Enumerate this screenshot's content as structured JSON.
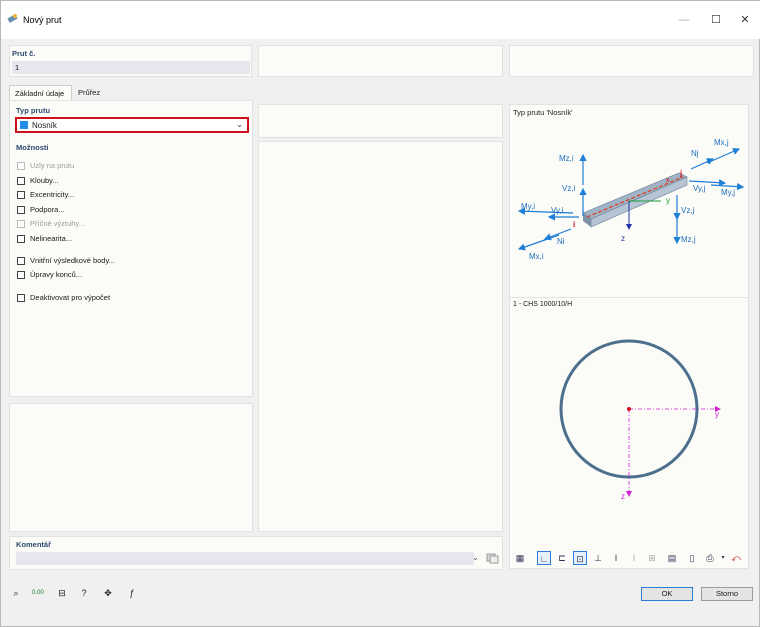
{
  "window": {
    "title": "Nový prut",
    "minimize_symbol": "—",
    "maximize_symbol": "☐",
    "close_symbol": "✕"
  },
  "header": {
    "member_no_label": "Prut č.",
    "member_no_value": "1"
  },
  "tabs": [
    {
      "label": "Základní údaje",
      "active": true
    },
    {
      "label": "Průřez",
      "active": false
    }
  ],
  "member_type": {
    "label": "Typ prutu",
    "value": "Nosník",
    "swatch_color": "#1e8ee6"
  },
  "options": {
    "label": "Možnosti",
    "items": [
      {
        "label": "Uzly na prutu",
        "checked": false,
        "enabled": false
      },
      {
        "label": "Klouby...",
        "checked": false,
        "enabled": true
      },
      {
        "label": "Excentricity...",
        "checked": false,
        "enabled": true
      },
      {
        "label": "Podpora...",
        "checked": false,
        "enabled": true
      },
      {
        "label": "Příčné výztuhy...",
        "checked": false,
        "enabled": false
      },
      {
        "label": "Nelinearita...",
        "checked": false,
        "enabled": true
      },
      {
        "label": "Vnitřní výsledkové body...",
        "checked": false,
        "enabled": true
      },
      {
        "label": "Úpravy konců...",
        "checked": false,
        "enabled": true
      },
      {
        "label": "Deaktivovat pro výpočet",
        "checked": false,
        "enabled": true
      }
    ]
  },
  "comment": {
    "label": "Komentář",
    "value": ""
  },
  "preview": {
    "member_type_title": "Typ prutu 'Nosník'",
    "section_title": "1 - CHS 1000/10/H",
    "beam_labels": {
      "mzi": "Mz,i",
      "vzi": "Vz,i",
      "myi": "My,i",
      "vyi": "Vy,i",
      "ni": "Ni",
      "mxi": "Mx,i",
      "i": "i",
      "j": "j",
      "x": "x",
      "y": "y",
      "z": "z",
      "nj": "Nj",
      "mxj": "Mx,j",
      "vyj": "Vy,j",
      "myj": "My,j",
      "vzj": "Vz,j",
      "mzj": "Mz,j"
    },
    "section_axis_y": "y",
    "section_axis_z": "z"
  },
  "buttons": {
    "ok": "OK",
    "cancel": "Storno"
  },
  "colors": {
    "accent_red": "#d0101e",
    "arrow_blue": "#1e7fd6",
    "axis_magenta": "#d21fd2",
    "section_ring": "#4d6f8e"
  }
}
